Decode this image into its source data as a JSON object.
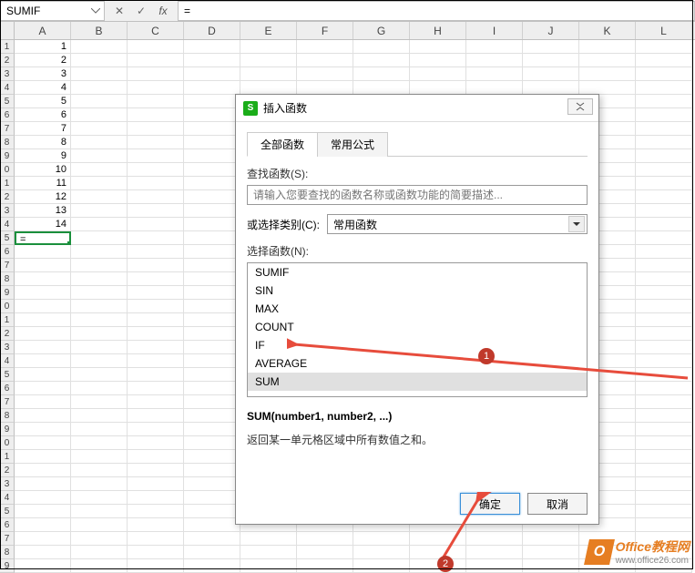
{
  "formula_bar": {
    "name_box": "SUMIF",
    "cancel": "✕",
    "confirm": "✓",
    "fx": "fx",
    "formula": "="
  },
  "columns": [
    "A",
    "B",
    "C",
    "D",
    "E",
    "F",
    "G",
    "H",
    "I",
    "J",
    "K",
    "L"
  ],
  "cells_a": [
    "1",
    "2",
    "3",
    "4",
    "5",
    "6",
    "7",
    "8",
    "9",
    "10",
    "11",
    "12",
    "13",
    "14"
  ],
  "active_cell_value": "=",
  "dialog": {
    "title": "插入函数",
    "close": "✕",
    "tab_all": "全部函数",
    "tab_common": "常用公式",
    "search_label": "查找函数(S):",
    "search_placeholder": "请输入您要查找的函数名称或函数功能的简要描述...",
    "category_label": "或选择类别(C):",
    "category_value": "常用函数",
    "select_label": "选择函数(N):",
    "functions": [
      "SUMIF",
      "SIN",
      "MAX",
      "COUNT",
      "IF",
      "AVERAGE",
      "SUM"
    ],
    "selected_index": 6,
    "signature": "SUM(number1, number2, ...)",
    "description": "返回某一单元格区域中所有数值之和。",
    "ok": "确定",
    "cancel": "取消"
  },
  "badges": {
    "b1": "1",
    "b2": "2"
  },
  "watermark": {
    "icon": "O",
    "title": "Office教程网",
    "url": "www.office26.com"
  }
}
